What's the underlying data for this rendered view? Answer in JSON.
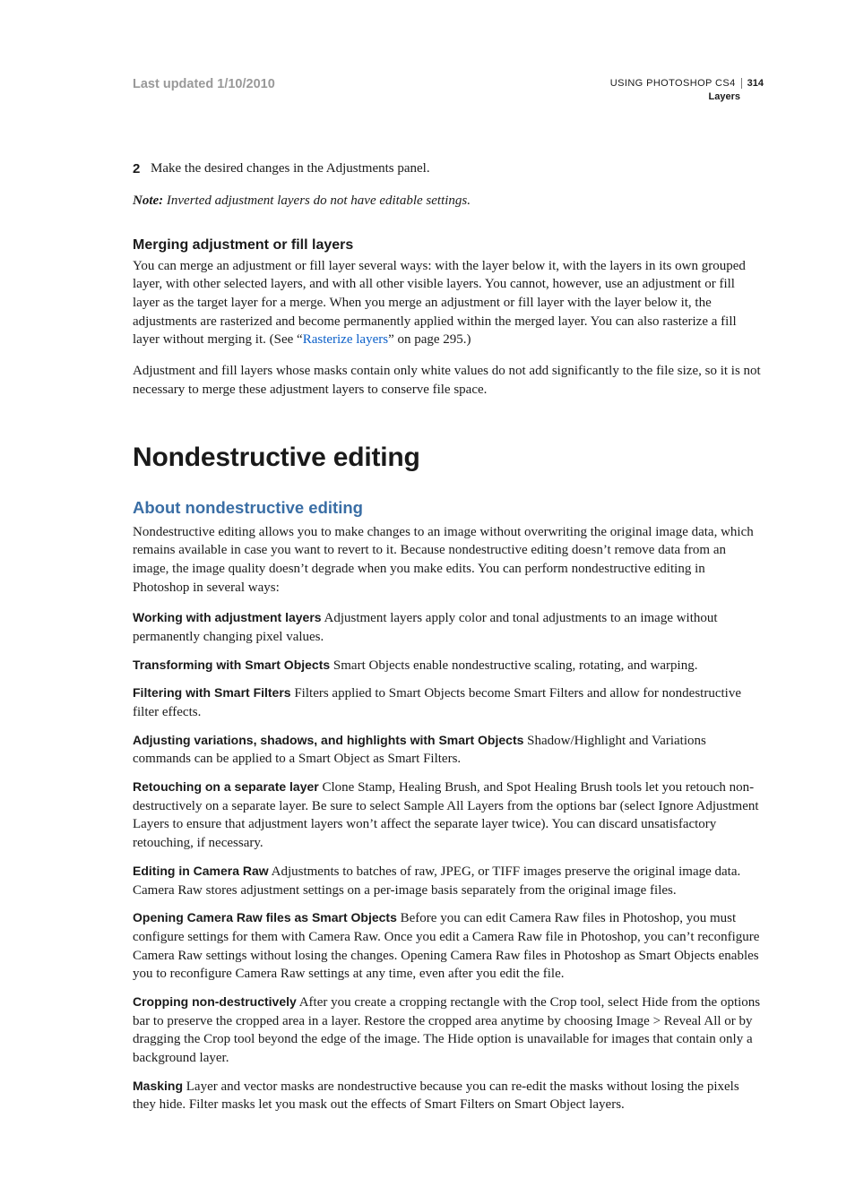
{
  "header": {
    "last_updated": "Last updated 1/10/2010",
    "product": "USING PHOTOSHOP CS4",
    "page_number": "314",
    "section": "Layers"
  },
  "step": {
    "num": "2",
    "text": "Make the desired changes in the Adjustments panel."
  },
  "note": {
    "label": "Note:",
    "text": " Inverted adjustment layers do not have editable settings."
  },
  "merge": {
    "heading": "Merging adjustment or fill layers",
    "p1a": "You can merge an adjustment or fill layer several ways: with the layer below it, with the layers in its own grouped layer, with other selected layers, and with all other visible layers. You cannot, however, use an adjustment or fill layer as the target layer for a merge. When you merge an adjustment or fill layer with the layer below it, the adjustments are rasterized and become permanently applied within the merged layer. You can also rasterize a fill layer without merging it. (See “",
    "link": "Rasterize layers",
    "p1b": "” on page 295.)",
    "p2": "Adjustment and fill layers whose masks contain only white values do not add significantly to the file size, so it is not necessary to merge these adjustment layers to conserve file space."
  },
  "nd": {
    "title": "Nondestructive editing",
    "about_heading": "About nondestructive editing",
    "intro": "Nondestructive editing allows you to make changes to an image without overwriting the original image data, which remains available in case you want to revert to it. Because nondestructive editing doesn’t remove data from an image, the image quality doesn’t degrade when you make edits. You can perform nondestructive editing in Photoshop in several ways:",
    "items": [
      {
        "term": "Working with adjustment layers",
        "desc": "  Adjustment layers apply color and tonal adjustments to an image without permanently changing pixel values."
      },
      {
        "term": "Transforming with Smart Objects",
        "desc": "  Smart Objects enable nondestructive scaling, rotating, and warping."
      },
      {
        "term": "Filtering with Smart Filters",
        "desc": "  Filters applied to Smart Objects become Smart Filters and allow for nondestructive filter effects."
      },
      {
        "term": "Adjusting variations, shadows, and highlights with Smart Objects",
        "desc": "  Shadow/Highlight and Variations commands can be applied to a Smart Object as Smart Filters."
      },
      {
        "term": "Retouching on a separate layer",
        "desc": "  Clone Stamp, Healing Brush, and Spot Healing Brush tools let you retouch non-destructively on a separate layer. Be sure to select Sample All Layers from the options bar (select Ignore Adjustment Layers to ensure that adjustment layers won’t affect the separate layer twice). You can discard unsatisfactory retouching, if necessary."
      },
      {
        "term": "Editing in Camera Raw",
        "desc": "  Adjustments to batches of raw, JPEG, or TIFF images preserve the original image data. Camera Raw stores adjustment settings on a per-image basis separately from the original image files."
      },
      {
        "term": "Opening Camera Raw files as Smart Objects",
        "desc": "  Before you can edit Camera Raw files in Photoshop, you must configure settings for them with Camera Raw. Once you edit a Camera Raw file in Photoshop, you can’t reconfigure Camera Raw settings without losing the changes. Opening Camera Raw files in Photoshop as Smart Objects enables you to reconfigure Camera Raw settings at any time, even after you edit the file."
      },
      {
        "term": "Cropping non-destructively",
        "desc": "  After you create a cropping rectangle with the Crop tool, select Hide from the options bar to preserve the cropped area in a layer. Restore the cropped area anytime by choosing Image > Reveal All or by dragging the Crop tool beyond the edge of the image. The Hide option is unavailable for images that contain only a background layer."
      },
      {
        "term": "Masking",
        "desc": "  Layer and vector masks are nondestructive because you can re-edit the masks without losing the pixels they hide. Filter masks let you mask out the effects of Smart Filters on Smart Object layers."
      }
    ]
  }
}
